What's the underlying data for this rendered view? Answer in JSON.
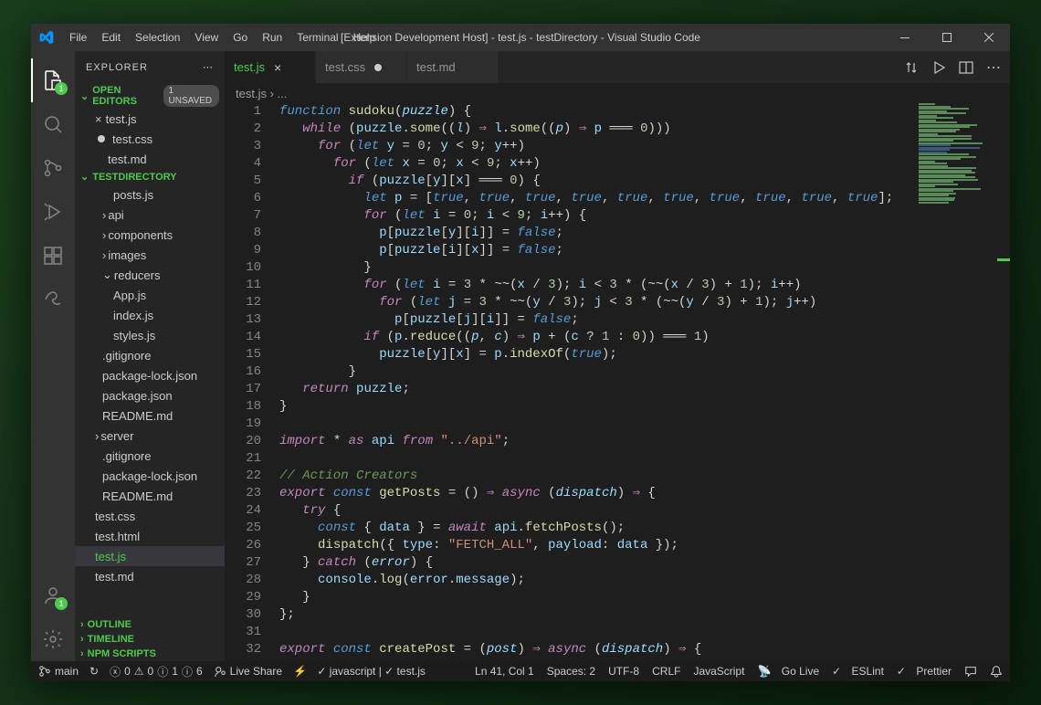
{
  "titlebar": {
    "title": "[Extension Development Host] - test.js - testDirectory - Visual Studio Code",
    "menu": [
      "File",
      "Edit",
      "Selection",
      "View",
      "Go",
      "Run",
      "Terminal",
      "Help"
    ]
  },
  "sidebar": {
    "title": "EXPLORER",
    "openEditors": {
      "label": "OPEN EDITORS",
      "unsaved": "1 UNSAVED",
      "items": [
        {
          "name": "test.js",
          "status": "close"
        },
        {
          "name": "test.css",
          "status": "dirty"
        },
        {
          "name": "test.md",
          "status": "none"
        }
      ]
    },
    "workspace": {
      "label": "TESTDIRECTORY",
      "tree": [
        {
          "name": "posts.js",
          "indent": 3,
          "kind": "file"
        },
        {
          "name": "api",
          "indent": 2,
          "kind": "folder"
        },
        {
          "name": "components",
          "indent": 2,
          "kind": "folder"
        },
        {
          "name": "images",
          "indent": 2,
          "kind": "folder"
        },
        {
          "name": "reducers",
          "indent": 2,
          "kind": "folder-open"
        },
        {
          "name": "App.js",
          "indent": 3,
          "kind": "file"
        },
        {
          "name": "index.js",
          "indent": 3,
          "kind": "file"
        },
        {
          "name": "styles.js",
          "indent": 3,
          "kind": "file"
        },
        {
          "name": ".gitignore",
          "indent": 2,
          "kind": "file"
        },
        {
          "name": "package-lock.json",
          "indent": 2,
          "kind": "file"
        },
        {
          "name": "package.json",
          "indent": 2,
          "kind": "file"
        },
        {
          "name": "README.md",
          "indent": 2,
          "kind": "file"
        },
        {
          "name": "server",
          "indent": 1,
          "kind": "folder"
        },
        {
          "name": ".gitignore",
          "indent": 2,
          "kind": "file"
        },
        {
          "name": "package-lock.json",
          "indent": 2,
          "kind": "file"
        },
        {
          "name": "README.md",
          "indent": 2,
          "kind": "file"
        },
        {
          "name": "test.css",
          "indent": 1,
          "kind": "file"
        },
        {
          "name": "test.html",
          "indent": 1,
          "kind": "file"
        },
        {
          "name": "test.js",
          "indent": 1,
          "kind": "file",
          "active": true
        },
        {
          "name": "test.md",
          "indent": 1,
          "kind": "file"
        }
      ]
    },
    "bottomSections": [
      "OUTLINE",
      "TIMELINE",
      "NPM SCRIPTS"
    ]
  },
  "tabs": [
    {
      "label": "test.js",
      "active": true,
      "dirty": false
    },
    {
      "label": "test.css",
      "active": false,
      "dirty": true
    },
    {
      "label": "test.md",
      "active": false,
      "dirty": false
    }
  ],
  "breadcrumb": "test.js › ...",
  "codeLines": [
    [
      [
        "kw2",
        "function"
      ],
      [
        "op",
        " "
      ],
      [
        "fn",
        "sudoku"
      ],
      [
        "pun",
        "("
      ],
      [
        "param",
        "puzzle"
      ],
      [
        "pun",
        ") {"
      ]
    ],
    [
      [
        "op",
        "   "
      ],
      [
        "kw",
        "while"
      ],
      [
        "op",
        " ("
      ],
      [
        "var",
        "puzzle"
      ],
      [
        "pun",
        "."
      ],
      [
        "fn",
        "some"
      ],
      [
        "pun",
        "(("
      ],
      [
        "param",
        "l"
      ],
      [
        "pun",
        ") "
      ],
      [
        "kw",
        "⇒"
      ],
      [
        "op",
        " "
      ],
      [
        "var",
        "l"
      ],
      [
        "pun",
        "."
      ],
      [
        "fn",
        "some"
      ],
      [
        "pun",
        "(("
      ],
      [
        "param",
        "p"
      ],
      [
        "pun",
        ") "
      ],
      [
        "kw",
        "⇒"
      ],
      [
        "op",
        " "
      ],
      [
        "var",
        "p"
      ],
      [
        "op",
        " ═══ "
      ],
      [
        "num",
        "0"
      ],
      [
        "pun",
        ")))"
      ]
    ],
    [
      [
        "op",
        "     "
      ],
      [
        "kw",
        "for"
      ],
      [
        "op",
        " ("
      ],
      [
        "kw2",
        "let"
      ],
      [
        "op",
        " "
      ],
      [
        "var",
        "y"
      ],
      [
        "op",
        " = "
      ],
      [
        "num",
        "0"
      ],
      [
        "pun",
        "; "
      ],
      [
        "var",
        "y"
      ],
      [
        "op",
        " < "
      ],
      [
        "num",
        "9"
      ],
      [
        "pun",
        "; "
      ],
      [
        "var",
        "y"
      ],
      [
        "op",
        "++"
      ],
      [
        "pun",
        ")"
      ]
    ],
    [
      [
        "op",
        "       "
      ],
      [
        "kw",
        "for"
      ],
      [
        "op",
        " ("
      ],
      [
        "kw2",
        "let"
      ],
      [
        "op",
        " "
      ],
      [
        "var",
        "x"
      ],
      [
        "op",
        " = "
      ],
      [
        "num",
        "0"
      ],
      [
        "pun",
        "; "
      ],
      [
        "var",
        "x"
      ],
      [
        "op",
        " < "
      ],
      [
        "num",
        "9"
      ],
      [
        "pun",
        "; "
      ],
      [
        "var",
        "x"
      ],
      [
        "op",
        "++"
      ],
      [
        "pun",
        ")"
      ]
    ],
    [
      [
        "op",
        "         "
      ],
      [
        "kw",
        "if"
      ],
      [
        "op",
        " ("
      ],
      [
        "var",
        "puzzle"
      ],
      [
        "pun",
        "["
      ],
      [
        "var",
        "y"
      ],
      [
        "pun",
        "]["
      ],
      [
        "var",
        "x"
      ],
      [
        "pun",
        "]"
      ],
      [
        "op",
        " ═══ "
      ],
      [
        "num",
        "0"
      ],
      [
        "pun",
        ") {"
      ]
    ],
    [
      [
        "op",
        "           "
      ],
      [
        "kw2",
        "let"
      ],
      [
        "op",
        " "
      ],
      [
        "var",
        "p"
      ],
      [
        "op",
        " = ["
      ],
      [
        "bool",
        "true"
      ],
      [
        "pun",
        ", "
      ],
      [
        "bool",
        "true"
      ],
      [
        "pun",
        ", "
      ],
      [
        "bool",
        "true"
      ],
      [
        "pun",
        ", "
      ],
      [
        "bool",
        "true"
      ],
      [
        "pun",
        ", "
      ],
      [
        "bool",
        "true"
      ],
      [
        "pun",
        ", "
      ],
      [
        "bool",
        "true"
      ],
      [
        "pun",
        ", "
      ],
      [
        "bool",
        "true"
      ],
      [
        "pun",
        ", "
      ],
      [
        "bool",
        "true"
      ],
      [
        "pun",
        ", "
      ],
      [
        "bool",
        "true"
      ],
      [
        "pun",
        ", "
      ],
      [
        "bool",
        "true"
      ],
      [
        "pun",
        "];"
      ]
    ],
    [
      [
        "op",
        "           "
      ],
      [
        "kw",
        "for"
      ],
      [
        "op",
        " ("
      ],
      [
        "kw2",
        "let"
      ],
      [
        "op",
        " "
      ],
      [
        "var",
        "i"
      ],
      [
        "op",
        " = "
      ],
      [
        "num",
        "0"
      ],
      [
        "pun",
        "; "
      ],
      [
        "var",
        "i"
      ],
      [
        "op",
        " < "
      ],
      [
        "num",
        "9"
      ],
      [
        "pun",
        "; "
      ],
      [
        "var",
        "i"
      ],
      [
        "op",
        "++"
      ],
      [
        "pun",
        ") {"
      ]
    ],
    [
      [
        "op",
        "             "
      ],
      [
        "var",
        "p"
      ],
      [
        "pun",
        "["
      ],
      [
        "var",
        "puzzle"
      ],
      [
        "pun",
        "["
      ],
      [
        "var",
        "y"
      ],
      [
        "pun",
        "]["
      ],
      [
        "var",
        "i"
      ],
      [
        "pun",
        "]] = "
      ],
      [
        "bool",
        "false"
      ],
      [
        "pun",
        ";"
      ]
    ],
    [
      [
        "op",
        "             "
      ],
      [
        "var",
        "p"
      ],
      [
        "pun",
        "["
      ],
      [
        "var",
        "puzzle"
      ],
      [
        "pun",
        "["
      ],
      [
        "var",
        "i"
      ],
      [
        "pun",
        "]["
      ],
      [
        "var",
        "x"
      ],
      [
        "pun",
        "]] = "
      ],
      [
        "bool",
        "false"
      ],
      [
        "pun",
        ";"
      ]
    ],
    [
      [
        "op",
        "           "
      ],
      [
        "pun",
        "}"
      ]
    ],
    [
      [
        "op",
        "           "
      ],
      [
        "kw",
        "for"
      ],
      [
        "op",
        " ("
      ],
      [
        "kw2",
        "let"
      ],
      [
        "op",
        " "
      ],
      [
        "var",
        "i"
      ],
      [
        "op",
        " = "
      ],
      [
        "num",
        "3"
      ],
      [
        "op",
        " * ~~("
      ],
      [
        "var",
        "x"
      ],
      [
        "op",
        " / "
      ],
      [
        "num",
        "3"
      ],
      [
        "pun",
        "); "
      ],
      [
        "var",
        "i"
      ],
      [
        "op",
        " < "
      ],
      [
        "num",
        "3"
      ],
      [
        "op",
        " * (~~("
      ],
      [
        "var",
        "x"
      ],
      [
        "op",
        " / "
      ],
      [
        "num",
        "3"
      ],
      [
        "pun",
        ") + "
      ],
      [
        "num",
        "1"
      ],
      [
        "pun",
        "); "
      ],
      [
        "var",
        "i"
      ],
      [
        "op",
        "++"
      ],
      [
        "pun",
        ")"
      ]
    ],
    [
      [
        "op",
        "             "
      ],
      [
        "kw",
        "for"
      ],
      [
        "op",
        " ("
      ],
      [
        "kw2",
        "let"
      ],
      [
        "op",
        " "
      ],
      [
        "var",
        "j"
      ],
      [
        "op",
        " = "
      ],
      [
        "num",
        "3"
      ],
      [
        "op",
        " * ~~("
      ],
      [
        "var",
        "y"
      ],
      [
        "op",
        " / "
      ],
      [
        "num",
        "3"
      ],
      [
        "pun",
        "); "
      ],
      [
        "var",
        "j"
      ],
      [
        "op",
        " < "
      ],
      [
        "num",
        "3"
      ],
      [
        "op",
        " * (~~("
      ],
      [
        "var",
        "y"
      ],
      [
        "op",
        " / "
      ],
      [
        "num",
        "3"
      ],
      [
        "pun",
        ") + "
      ],
      [
        "num",
        "1"
      ],
      [
        "pun",
        "); "
      ],
      [
        "var",
        "j"
      ],
      [
        "op",
        "++"
      ],
      [
        "pun",
        ")"
      ]
    ],
    [
      [
        "op",
        "               "
      ],
      [
        "var",
        "p"
      ],
      [
        "pun",
        "["
      ],
      [
        "var",
        "puzzle"
      ],
      [
        "pun",
        "["
      ],
      [
        "var",
        "j"
      ],
      [
        "pun",
        "]["
      ],
      [
        "var",
        "i"
      ],
      [
        "pun",
        "]] = "
      ],
      [
        "bool",
        "false"
      ],
      [
        "pun",
        ";"
      ]
    ],
    [
      [
        "op",
        "           "
      ],
      [
        "kw",
        "if"
      ],
      [
        "op",
        " ("
      ],
      [
        "var",
        "p"
      ],
      [
        "pun",
        "."
      ],
      [
        "fn",
        "reduce"
      ],
      [
        "pun",
        "(("
      ],
      [
        "param",
        "p"
      ],
      [
        "pun",
        ", "
      ],
      [
        "param",
        "c"
      ],
      [
        "pun",
        ") "
      ],
      [
        "kw",
        "⇒"
      ],
      [
        "op",
        " "
      ],
      [
        "var",
        "p"
      ],
      [
        "op",
        " + ("
      ],
      [
        "var",
        "c"
      ],
      [
        "op",
        " ? "
      ],
      [
        "num",
        "1"
      ],
      [
        "op",
        " : "
      ],
      [
        "num",
        "0"
      ],
      [
        "pun",
        ")) ═══ "
      ],
      [
        "num",
        "1"
      ],
      [
        "pun",
        ")"
      ]
    ],
    [
      [
        "op",
        "             "
      ],
      [
        "var",
        "puzzle"
      ],
      [
        "pun",
        "["
      ],
      [
        "var",
        "y"
      ],
      [
        "pun",
        "]["
      ],
      [
        "var",
        "x"
      ],
      [
        "pun",
        "] = "
      ],
      [
        "var",
        "p"
      ],
      [
        "pun",
        "."
      ],
      [
        "fn",
        "indexOf"
      ],
      [
        "pun",
        "("
      ],
      [
        "bool",
        "true"
      ],
      [
        "pun",
        ");"
      ]
    ],
    [
      [
        "op",
        "         "
      ],
      [
        "pun",
        "}"
      ]
    ],
    [
      [
        "op",
        "   "
      ],
      [
        "kw",
        "return"
      ],
      [
        "op",
        " "
      ],
      [
        "var",
        "puzzle"
      ],
      [
        "pun",
        ";"
      ]
    ],
    [
      [
        "pun",
        "}"
      ]
    ],
    [],
    [
      [
        "kw",
        "import"
      ],
      [
        "op",
        " * "
      ],
      [
        "kw",
        "as"
      ],
      [
        "op",
        " "
      ],
      [
        "var",
        "api"
      ],
      [
        "op",
        " "
      ],
      [
        "kw",
        "from"
      ],
      [
        "op",
        " "
      ],
      [
        "str",
        "\"../api\""
      ],
      [
        "pun",
        ";"
      ]
    ],
    [],
    [
      [
        "cmt",
        "// Action Creators"
      ]
    ],
    [
      [
        "kw",
        "export"
      ],
      [
        "op",
        " "
      ],
      [
        "kw2",
        "const"
      ],
      [
        "op",
        " "
      ],
      [
        "fn",
        "getPosts"
      ],
      [
        "op",
        " = () "
      ],
      [
        "kw",
        "⇒"
      ],
      [
        "op",
        " "
      ],
      [
        "kw",
        "async"
      ],
      [
        "op",
        " ("
      ],
      [
        "param",
        "dispatch"
      ],
      [
        "pun",
        ") "
      ],
      [
        "kw",
        "⇒"
      ],
      [
        "pun",
        " {"
      ]
    ],
    [
      [
        "op",
        "   "
      ],
      [
        "kw",
        "try"
      ],
      [
        "pun",
        " {"
      ]
    ],
    [
      [
        "op",
        "     "
      ],
      [
        "kw2",
        "const"
      ],
      [
        "op",
        " { "
      ],
      [
        "var",
        "data"
      ],
      [
        "op",
        " } = "
      ],
      [
        "kw",
        "await"
      ],
      [
        "op",
        " "
      ],
      [
        "var",
        "api"
      ],
      [
        "pun",
        "."
      ],
      [
        "fn",
        "fetchPosts"
      ],
      [
        "pun",
        "();"
      ]
    ],
    [
      [
        "op",
        "     "
      ],
      [
        "fn",
        "dispatch"
      ],
      [
        "pun",
        "({ "
      ],
      [
        "var",
        "type"
      ],
      [
        "pun",
        ": "
      ],
      [
        "str",
        "\"FETCH_ALL\""
      ],
      [
        "pun",
        ", "
      ],
      [
        "var",
        "payload"
      ],
      [
        "pun",
        ": "
      ],
      [
        "var",
        "data"
      ],
      [
        "pun",
        " });"
      ]
    ],
    [
      [
        "op",
        "   } "
      ],
      [
        "kw",
        "catch"
      ],
      [
        "op",
        " ("
      ],
      [
        "param",
        "error"
      ],
      [
        "pun",
        ") {"
      ]
    ],
    [
      [
        "op",
        "     "
      ],
      [
        "var",
        "console"
      ],
      [
        "pun",
        "."
      ],
      [
        "fn",
        "log"
      ],
      [
        "pun",
        "("
      ],
      [
        "var",
        "error"
      ],
      [
        "pun",
        "."
      ],
      [
        "var",
        "message"
      ],
      [
        "pun",
        ");"
      ]
    ],
    [
      [
        "op",
        "   "
      ],
      [
        "pun",
        "}"
      ]
    ],
    [
      [
        "pun",
        "};"
      ]
    ],
    [],
    [
      [
        "kw",
        "export"
      ],
      [
        "op",
        " "
      ],
      [
        "kw2",
        "const"
      ],
      [
        "op",
        " "
      ],
      [
        "fn",
        "createPost"
      ],
      [
        "op",
        " = ("
      ],
      [
        "param",
        "post"
      ],
      [
        "pun",
        ") "
      ],
      [
        "kw",
        "⇒"
      ],
      [
        "op",
        " "
      ],
      [
        "kw",
        "async"
      ],
      [
        "op",
        " ("
      ],
      [
        "param",
        "dispatch"
      ],
      [
        "pun",
        ") "
      ],
      [
        "kw",
        "⇒"
      ],
      [
        "pun",
        " {"
      ]
    ]
  ],
  "statusbar": {
    "branch": "main",
    "sync": "↻",
    "errors": "0",
    "warnings": "0",
    "hints_a": "1",
    "hints_b": "6",
    "liveShare": "Live Share",
    "langStatus": "✓ javascript | ✓ test.js",
    "cursor": "Ln 41, Col 1",
    "spaces": "Spaces: 2",
    "encoding": "UTF-8",
    "eol": "CRLF",
    "language": "JavaScript",
    "goLive": "Go Live",
    "eslint": "ESLint",
    "prettier": "Prettier"
  },
  "activityBadges": {
    "explorer": "1",
    "accounts": "1"
  }
}
